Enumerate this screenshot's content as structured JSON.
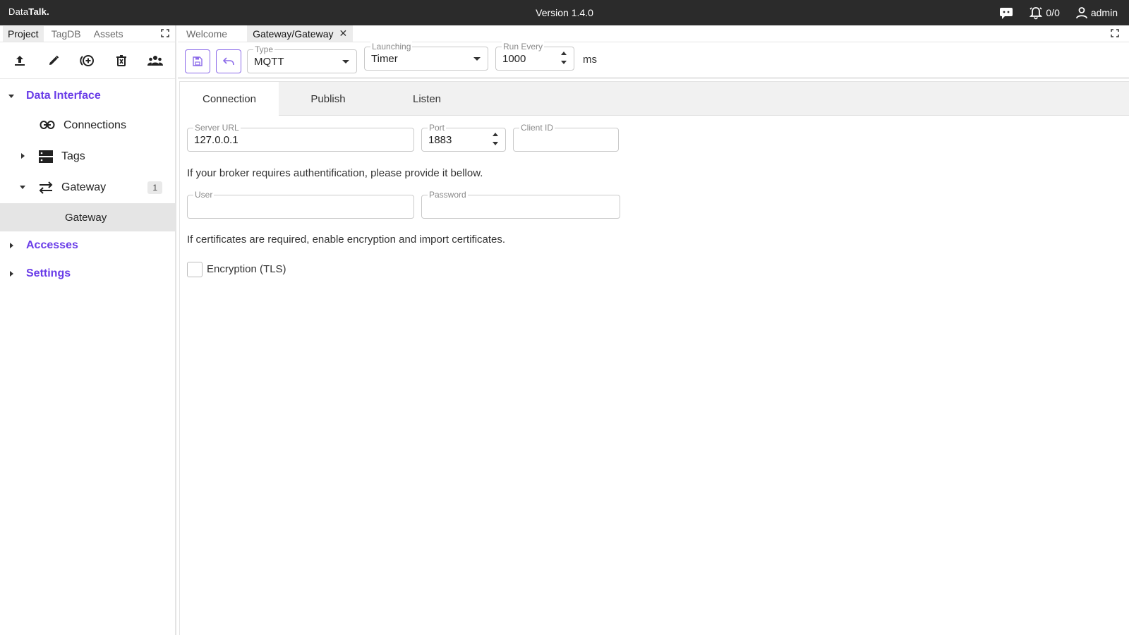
{
  "app": {
    "brand_part1": "Data",
    "brand_part2": "Talk.",
    "version": "Version 1.4.0",
    "alarms_count": "0/0",
    "user_name": "admin"
  },
  "left_panel": {
    "tabs": [
      "Project",
      "TagDB",
      "Assets"
    ],
    "active_tab": "Project",
    "tree": {
      "data_interface": "Data Interface",
      "connections": "Connections",
      "tags": "Tags",
      "gateway": "Gateway",
      "gateway_badge": "1",
      "gateway_child": "Gateway",
      "accesses": "Accesses",
      "settings": "Settings"
    }
  },
  "doc_tabs": {
    "welcome": "Welcome",
    "active": "Gateway/Gateway",
    "close_glyph": "✕"
  },
  "toolbar": {
    "type_label": "Type",
    "type_value": "MQTT",
    "launching_label": "Launching",
    "launching_value": "Timer",
    "run_every_label": "Run Every",
    "run_every_value": "1000",
    "run_every_unit": "ms"
  },
  "content_tabs": [
    "Connection",
    "Publish",
    "Listen"
  ],
  "connection": {
    "server_url_label": "Server URL",
    "server_url_value": "127.0.0.1",
    "port_label": "Port",
    "port_value": "1883",
    "client_id_label": "Client ID",
    "client_id_value": "",
    "auth_info": "If your broker requires authentification, please provide it bellow.",
    "user_label": "User",
    "user_value": "",
    "password_label": "Password",
    "password_value": "",
    "cert_info": "If certificates are required, enable encryption and import certificates.",
    "encryption_label": "Encryption (TLS)",
    "encryption_checked": false
  },
  "colors": {
    "accent": "#6a3de8",
    "topbar": "#2b2b2b"
  }
}
